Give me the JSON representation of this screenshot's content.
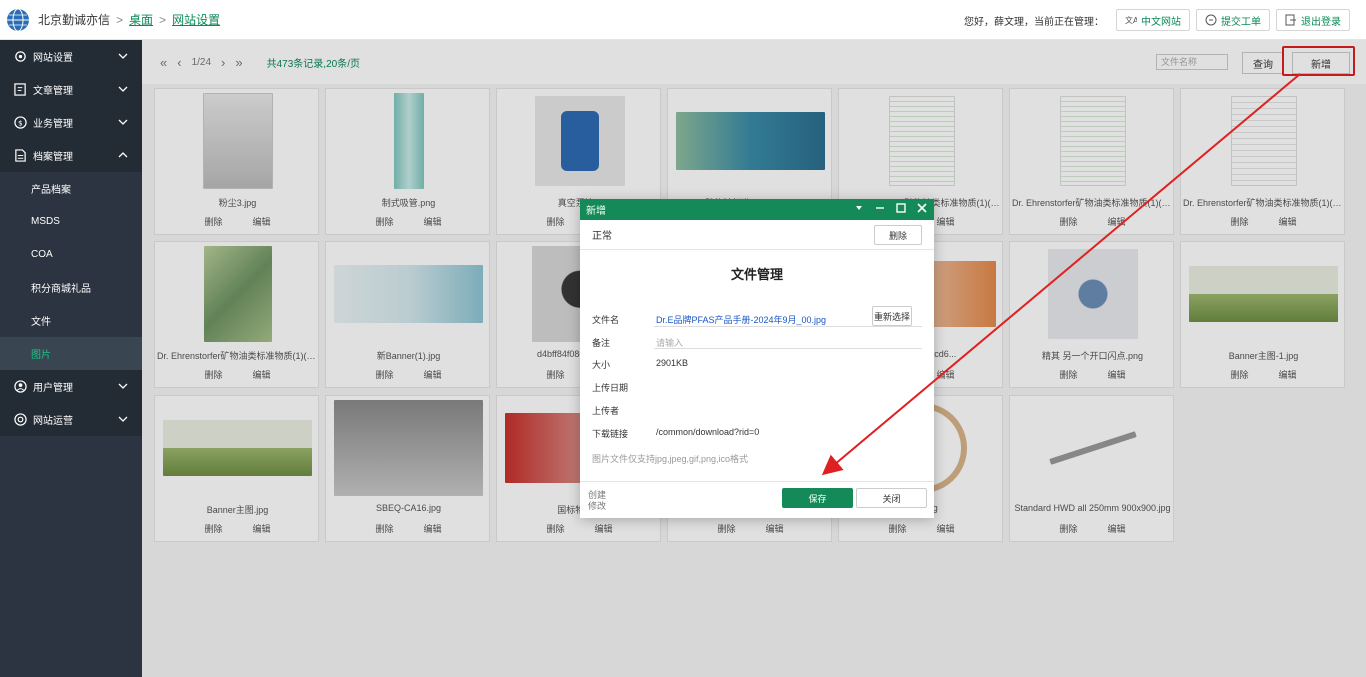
{
  "header": {
    "brand": "北京勤诚亦信",
    "breadcrumb": [
      "桌面",
      "网站设置"
    ],
    "greeting": "您好，薛文理，当前正在管理：",
    "buttons": [
      {
        "label": "中文网站",
        "icon": "translate-icon"
      },
      {
        "label": "提交工单",
        "icon": "ticket-icon"
      },
      {
        "label": "退出登录",
        "icon": "logout-icon"
      }
    ]
  },
  "sidebar": {
    "items": [
      {
        "label": "网站设置",
        "icon": "gear-icon",
        "expanded": false
      },
      {
        "label": "文章管理",
        "icon": "edit-icon",
        "expanded": false
      },
      {
        "label": "业务管理",
        "icon": "dollar-icon",
        "expanded": false
      },
      {
        "label": "档案管理",
        "icon": "document-icon",
        "expanded": true
      },
      {
        "label": "用户管理",
        "icon": "user-icon",
        "expanded": false
      },
      {
        "label": "网站运营",
        "icon": "target-icon",
        "expanded": false
      }
    ],
    "subitems": [
      "产品档案",
      "MSDS",
      "COA",
      "积分商城礼品",
      "文件",
      "图片"
    ],
    "active_sub": "图片",
    "active_color": "#18c583"
  },
  "toolbar": {
    "page": "1/24",
    "total": "共473条记录,20条/页",
    "search_placeholder": "文件名称",
    "query_label": "查询",
    "add_label": "新增"
  },
  "cards": [
    {
      "caption": "粉尘3.jpg"
    },
    {
      "caption": "制式吸管.png"
    },
    {
      "caption": "真空泵油..."
    },
    {
      "caption": "矿物油标准banner.png"
    },
    {
      "caption": "Dr. Ehrenstorfer矿物油类标准物质(1)(1)..."
    },
    {
      "caption": "Dr. Ehrenstorfer矿物油类标准物质(1)(1)..."
    },
    {
      "caption": "Dr. Ehrenstorfer矿物油类标准物质(1)(1)..."
    },
    {
      "caption": "Dr. Ehrenstorfer矿物油类标准物质(1)(1)..."
    },
    {
      "caption": "新Banner(1).jpg"
    },
    {
      "caption": "d4bff84f08d9faaf2d..."
    },
    {
      "caption": "..."
    },
    {
      "caption": "...209dade1cd6..."
    },
    {
      "caption": "精其 另一个开口闪点.png"
    },
    {
      "caption": "Banner主图-1.jpg"
    },
    {
      "caption": "Banner主图.jpg"
    },
    {
      "caption": "SBEQ-CA16.jpg"
    },
    {
      "caption": "国标物ba..."
    },
    {
      "caption": "..."
    },
    {
      "caption": "...PT.jpg"
    },
    {
      "caption": "Standard HWD all 250mm 900x900.jpg"
    }
  ],
  "card_actions": {
    "delete": "删除",
    "edit": "编辑"
  },
  "dialog": {
    "title": "新增",
    "status": "正常",
    "delete_label": "删除",
    "heading": "文件管理",
    "fields": {
      "filename_label": "文件名",
      "filename_value": "Dr.E品牌PFAS产品手册-2024年9月_00.jpg",
      "reselect_label": "重新选择",
      "note_label": "备注",
      "note_placeholder": "请输入",
      "size_label": "大小",
      "size_value": "2901KB",
      "upload_date_label": "上传日期",
      "uploader_label": "上传者",
      "download_label": "下载链接",
      "download_value": "/common/download?rid=0"
    },
    "hint": "图片文件仅支持jpg,jpeg,gif,png,ico格式",
    "footer_created": "创建",
    "footer_modified": "修改",
    "save_label": "保存",
    "close_label": "关闭"
  },
  "colors": {
    "accent": "#138a57",
    "highlight": "#e02020",
    "sidebar": "#2b3440"
  }
}
